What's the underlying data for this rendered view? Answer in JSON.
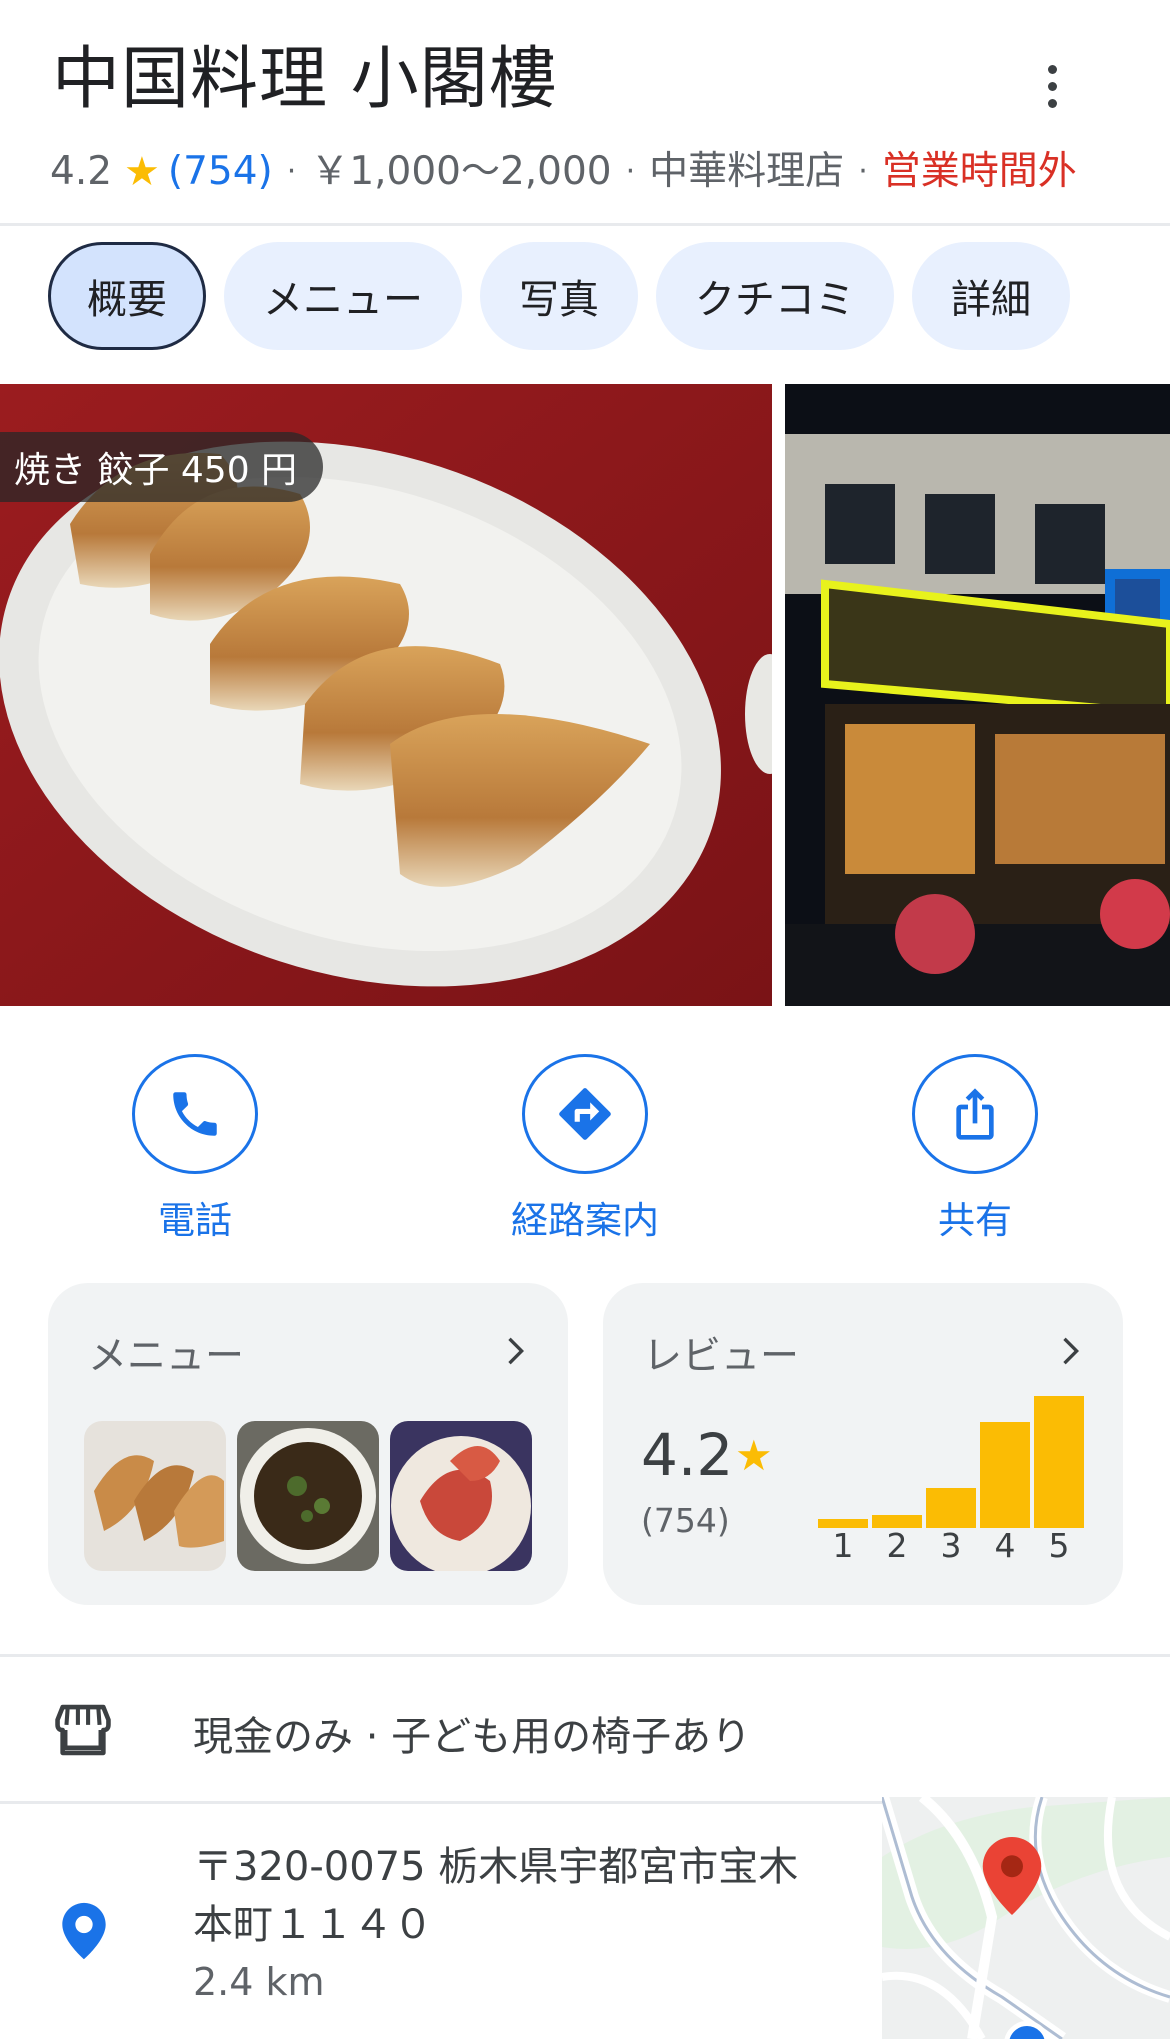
{
  "header": {
    "title": "中国料理 小閣樓",
    "rating": "4.2",
    "star": "★",
    "review_count": "(754)",
    "sep": "·",
    "price": "￥1,000～2,000",
    "category": "中華料理店",
    "status": "営業時間外",
    "status_color": "#d93025"
  },
  "tabs": [
    {
      "label": "概要",
      "active": true
    },
    {
      "label": "メニュー",
      "active": false
    },
    {
      "label": "写真",
      "active": false
    },
    {
      "label": "クチコミ",
      "active": false
    },
    {
      "label": "詳細",
      "active": false
    }
  ],
  "photos": {
    "main_caption": "焼き 餃子 450 円"
  },
  "actions": [
    {
      "label": "電話",
      "icon": "phone-icon"
    },
    {
      "label": "経路案内",
      "icon": "directions-icon"
    },
    {
      "label": "共有",
      "icon": "share-icon"
    }
  ],
  "menu_card": {
    "title": "メニュー"
  },
  "review_card": {
    "title": "レビュー",
    "rating": "4.2",
    "star": "★",
    "count": "(754)",
    "distribution": [
      {
        "stars": "1",
        "fraction": 0.07
      },
      {
        "stars": "2",
        "fraction": 0.1
      },
      {
        "stars": "3",
        "fraction": 0.3
      },
      {
        "stars": "4",
        "fraction": 0.8
      },
      {
        "stars": "5",
        "fraction": 1.0
      }
    ]
  },
  "info": {
    "amenities": "現金のみ · 子ども用の椅子あり",
    "address_line1": "〒320-0075 栃木県宇都宮市宝木",
    "address_line2": "本町１１４０",
    "distance": "2.4 km"
  },
  "colors": {
    "accent": "#1a73e8",
    "star": "#fbbc04",
    "tab_bg": "#e8f0fe",
    "tab_active_bg": "#d3e3fd"
  }
}
